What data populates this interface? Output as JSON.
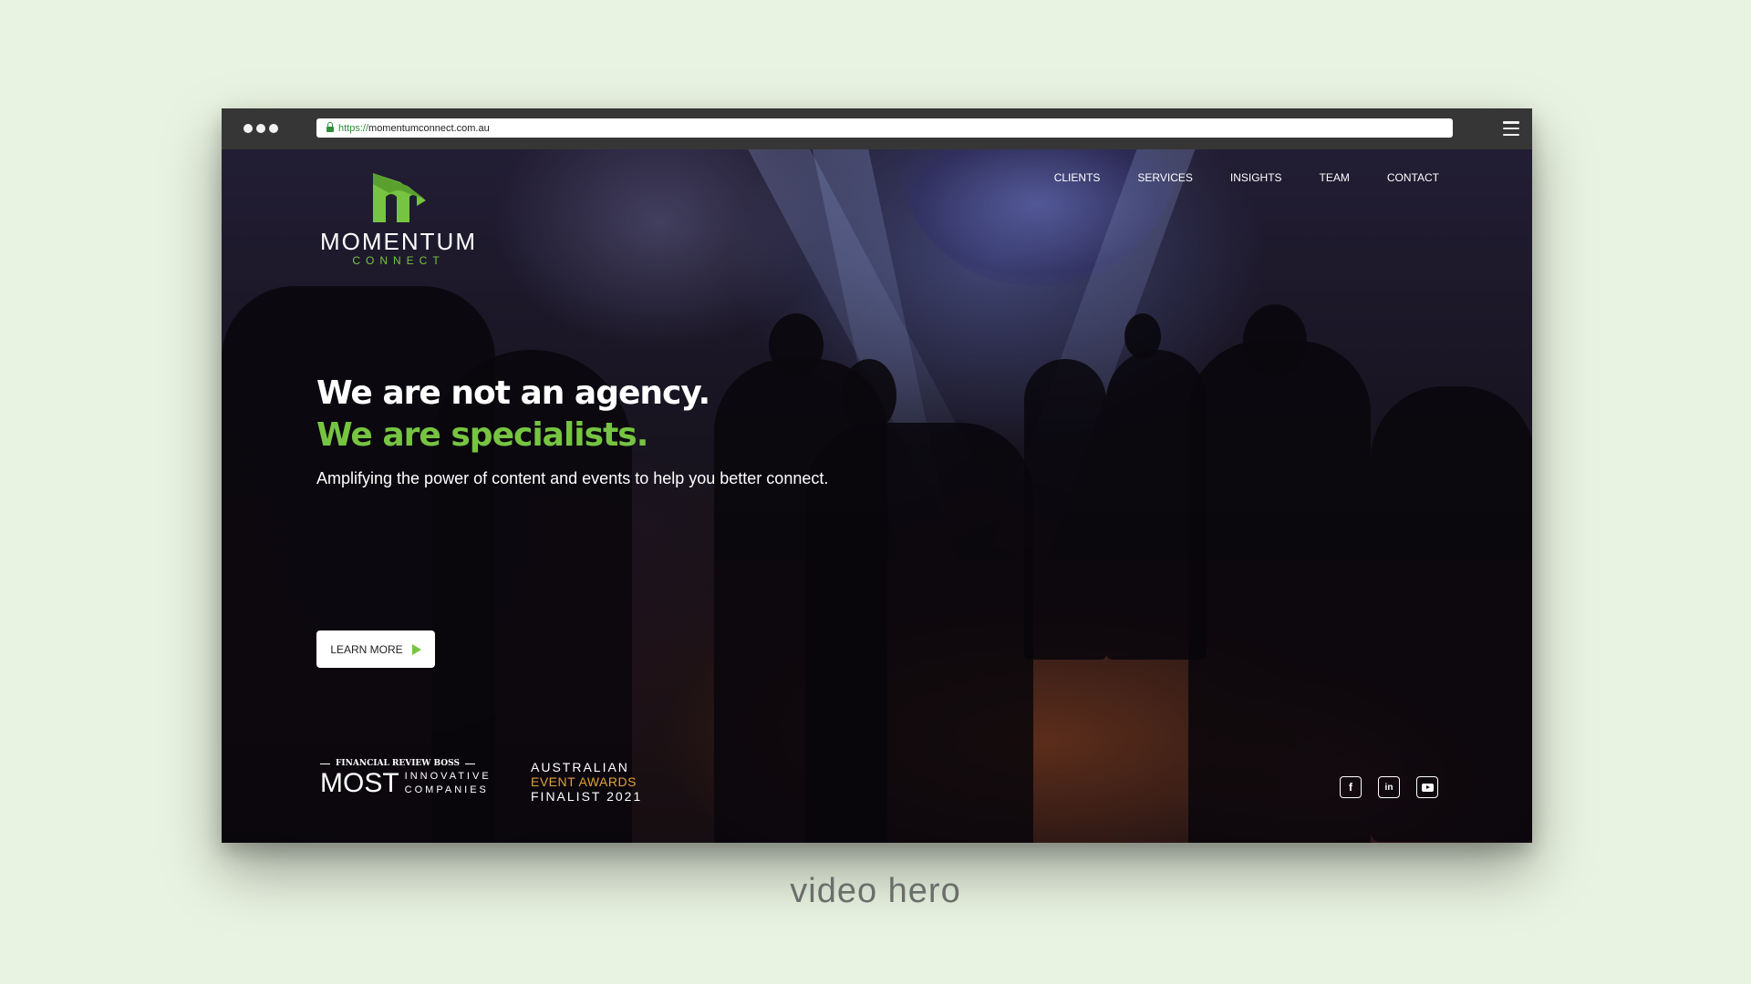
{
  "browser": {
    "url_scheme": "https://",
    "url_host": "momentumconnect.com.au"
  },
  "logo": {
    "word": "MOMENTUM",
    "sub": "CONNECT",
    "brand_color": "#76c442"
  },
  "nav": {
    "items": [
      {
        "label": "CLIENTS"
      },
      {
        "label": "SERVICES"
      },
      {
        "label": "INSIGHTS"
      },
      {
        "label": "TEAM"
      },
      {
        "label": "CONTACT"
      }
    ]
  },
  "hero": {
    "headline": "We are not an agency.",
    "headline_accent": "We are specialists.",
    "tagline": "Amplifying the power of content and events to help you better connect.",
    "cta_label": "LEARN MORE",
    "accent_color": "#76c442"
  },
  "awards": {
    "afr": {
      "top": "FINANCIAL REVIEW BOSS",
      "most": "MOST",
      "line1": "INNOVATIVE",
      "line2": "COMPANIES"
    },
    "aea": {
      "line1": "AUSTRALIAN",
      "line2": "EVENT AWARDS",
      "line3": "FINALIST 2021"
    }
  },
  "social": {
    "facebook": "f",
    "linkedin": "in",
    "youtube_icon": "youtube-icon"
  },
  "caption": "video hero"
}
